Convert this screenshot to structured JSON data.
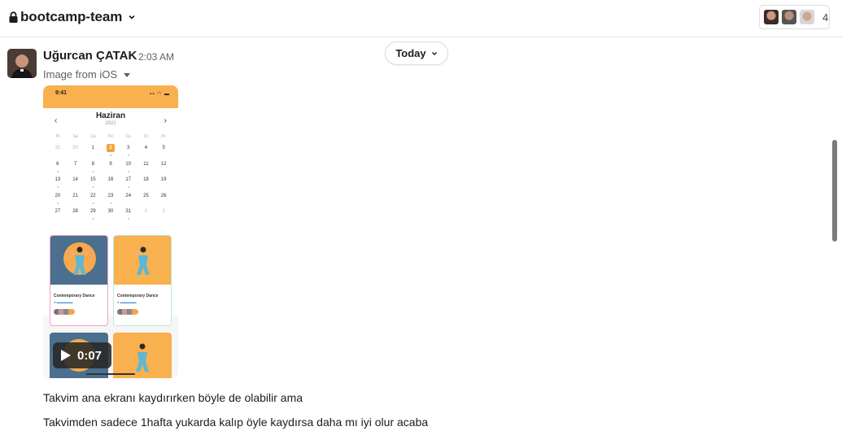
{
  "header": {
    "channel_name": "bootcamp-team",
    "member_count": "4"
  },
  "today_pill": {
    "label": "Today"
  },
  "message": {
    "sender": "Uğurcan ÇATAK",
    "time": "2:03 AM",
    "file_label": "Image from iOS",
    "video": {
      "duration": "0:07",
      "phone_time": "9:41",
      "month": "Haziran",
      "year": "2022",
      "day_names": [
        "Pt",
        "Sa",
        "Ça",
        "Pe",
        "Cu",
        "Ct",
        "Pz"
      ],
      "days": [
        "31",
        "30",
        "1",
        "2",
        "3",
        "4",
        "5",
        "6",
        "7",
        "8",
        "9",
        "10",
        "11",
        "12",
        "13",
        "14",
        "15",
        "16",
        "17",
        "18",
        "19",
        "20",
        "21",
        "22",
        "23",
        "24",
        "25",
        "26",
        "27",
        "28",
        "29",
        "30",
        "31",
        "1",
        "2"
      ],
      "card_title": "Contemporary Dance"
    },
    "lines": [
      "Takvim ana ekranı kaydırırken böyle de olabilir ama",
      "Takvimden sadece 1hafta yukarda kalıp öyle kaydırsa daha mı iyi olur acaba"
    ]
  },
  "colors": {
    "accent_orange": "#f9b04e",
    "card_blue": "#4a6f8f",
    "text": "#1d1c1d",
    "muted": "#616061"
  }
}
